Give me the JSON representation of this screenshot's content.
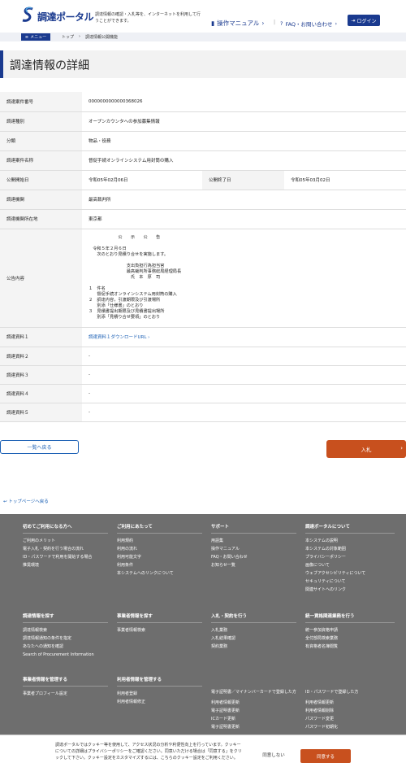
{
  "header": {
    "logo_text": "調達ポータル",
    "tagline": "調達情報の確認・入札等を、インターネットを利用して行うことができます。",
    "manual_label": "操作マニュアル",
    "faq_label": "FAQ・お問い合わせ",
    "login_label": "ログイン"
  },
  "breadcrumb": {
    "menu_label": "メニュー",
    "items": [
      "トップ",
      "調達情報公開機能"
    ]
  },
  "page_title": "調達情報の詳細",
  "details": {
    "case_no_label": "調達案件番号",
    "case_no": "0000000000000368026",
    "type_label": "調達種別",
    "type": "オープンカウンタへの参加募集情報",
    "category_label": "分類",
    "category": "物品・役務",
    "name_label": "調達案件名称",
    "name": "督促手続オンラインシステム用封筒の購入",
    "start_label": "公開開始日",
    "start": "令和05年02月06日",
    "end_label": "公開終了日",
    "end": "令和05年03月02日",
    "org_label": "調達機関",
    "org": "最高裁判所",
    "loc_label": "調達機関所在地",
    "loc": "東京都",
    "notice_label": "公告内容",
    "notice": "　　　　　　　公　　示　　公　　告\n\n　令和５年２月６日\n　　次のとおり見積り合せを実施します。\n\n　　　　　　　　　支出負担行為担当官\n　　　　　　　　　最高裁判所事務総局経理局長\n　　　　　　　　　　氏　本　厚　司\n\n１　件名\n　　督促手続オンラインシステム用封筒の購入\n２　調達内容，引渡期限及び引渡場所\n　　別添「仕様書」のとおり\n３　見積書提出期限及び見積書提出場所\n　　別添「見積り合せ要領」のとおり",
    "doc1_label": "調達資料１",
    "doc1": "調達資料１ダウンロードURL",
    "doc2_label": "調達資料２",
    "doc2": "-",
    "doc3_label": "調達資料３",
    "doc3": "-",
    "doc4_label": "調達資料４",
    "doc4": "-",
    "doc5_label": "調達資料５",
    "doc5": "-"
  },
  "actions": {
    "back_label": "一覧へ戻る",
    "bid_label": "入札",
    "top_label": "トップページへ戻る"
  },
  "footer": {
    "c1_title": "初めてご利用になる方へ",
    "c1_items": [
      "ご利用のメリット",
      "電子入札・契約を行う場合の流れ",
      "ID・パスワードで利用を開始する場合",
      "推奨環境"
    ],
    "c2_title": "ご利用にあたって",
    "c2_items": [
      "利用規約",
      "利用の流れ",
      "利用可能文字",
      "利用条件",
      "本システムへのリンクについて"
    ],
    "c3_title": "サポート",
    "c3_items": [
      "用語集",
      "操作マニュアル",
      "FAQ・お問い合わせ",
      "お知らせ一覧"
    ],
    "c4_title": "調達ポータルについて",
    "c4_items": [
      "本システムの説明",
      "本システムの対象範囲",
      "プライバシーポリシー",
      "画像について",
      "ウェブアクセシビリティについて",
      "セキュリティについて",
      "関連サイトへのリンク"
    ],
    "c5_title": "調達情報を探す",
    "c5_items": [
      "調達情報検索",
      "調達情報通知の条件を指定",
      "あなたへの通知を確認",
      "Search of Procurement Information"
    ],
    "c6_title": "事業者情報を探す",
    "c6_items": [
      "事業者情報検索"
    ],
    "c7_title": "入札・契約を行う",
    "c7_items": [
      "入札業務",
      "入札結果確認",
      "契約業務"
    ],
    "c8_title": "統一資格関連業務を行う",
    "c8_items": [
      "統一参加資格申請",
      "全付部局検索業務",
      "有資格者名簿閲覧"
    ],
    "c9_title": "事業者情報を管理する",
    "c9_items": [
      "事業者プロフィール設定"
    ],
    "c10_title": "利用者情報を管理する",
    "c10_items": [
      "利用者登録",
      "利用者情報修正"
    ],
    "c11_title": "電子証明書／マイナンバーカードで登録した方",
    "c11_items": [
      "利用者情報更新",
      "電子証明書更新",
      "ICカード更新",
      "電子証明書更新"
    ],
    "c12_title": "ID・パスワードで登録した方",
    "c12_items": [
      "利用者情報更新",
      "利用者情報削除",
      "パスワード変更",
      "パスワード初期化"
    ]
  },
  "cookie": {
    "text": "調達ポータルではクッキー等を使用して、アクセス状況の分析や利便性向上を行っています。クッキーについての詳細はプライバシーポリシーをご確認ください。同意いただける場合は「同意する」をクリックして下さい。クッキー設定をカスタマイズするには、こちらのクッキー設定をご利用ください。",
    "decline_label": "同意しない",
    "accept_label": "同意する"
  },
  "colors": {
    "brand": "#1a3a8f",
    "accent": "#c8501e",
    "footer": "#6e6e6e"
  }
}
